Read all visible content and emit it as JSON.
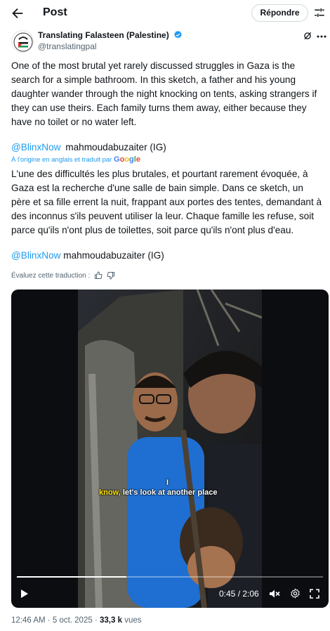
{
  "header": {
    "title": "Post",
    "reply_label": "Répondre"
  },
  "author": {
    "name": "Translating Falasteen (Palestine)",
    "handle": "@translatingpal"
  },
  "tweet": {
    "original_text": "One of the most brutal yet rarely discussed struggles in Gaza is the search for a simple bathroom. In this sketch, a father and his young daughter wander through the night knocking on tents, asking strangers if they can use theirs. Each family turns them away, either because they have no toilet or no water left.",
    "mention": "@BlinxNow",
    "credit": "mahmoudabuzaiter (IG)",
    "translated_note": "À l'origine en anglais et traduit par",
    "translator_logo": "Google",
    "translated_text": "L'une des difficultés les plus brutales, et pourtant rarement évoquée, à Gaza est la recherche d'une salle de bain simple. Dans ce sketch, un père et sa fille errent la nuit, frappant aux portes des tentes, demandant à des inconnus s'ils peuvent utiliser la leur. Chaque famille les refuse, soit parce qu'ils n'ont plus de toilettes, soit parce qu'ils n'ont plus d'eau.",
    "rate_label": "Évaluez cette traduction :"
  },
  "video": {
    "caption_cursor": "I",
    "caption_highlight": "know,",
    "caption_rest": " let's look at another place",
    "time": "0:45 / 2:06",
    "progress_fraction": 0.357
  },
  "meta": {
    "time": "12:46 AM",
    "date": "5 oct. 2025",
    "views": "33,3 k",
    "views_label": "vues",
    "separator": "·"
  },
  "colors": {
    "link": "#1d9bf0",
    "verified": "#1d9bf0",
    "caption_highlight": "#ffe600"
  }
}
